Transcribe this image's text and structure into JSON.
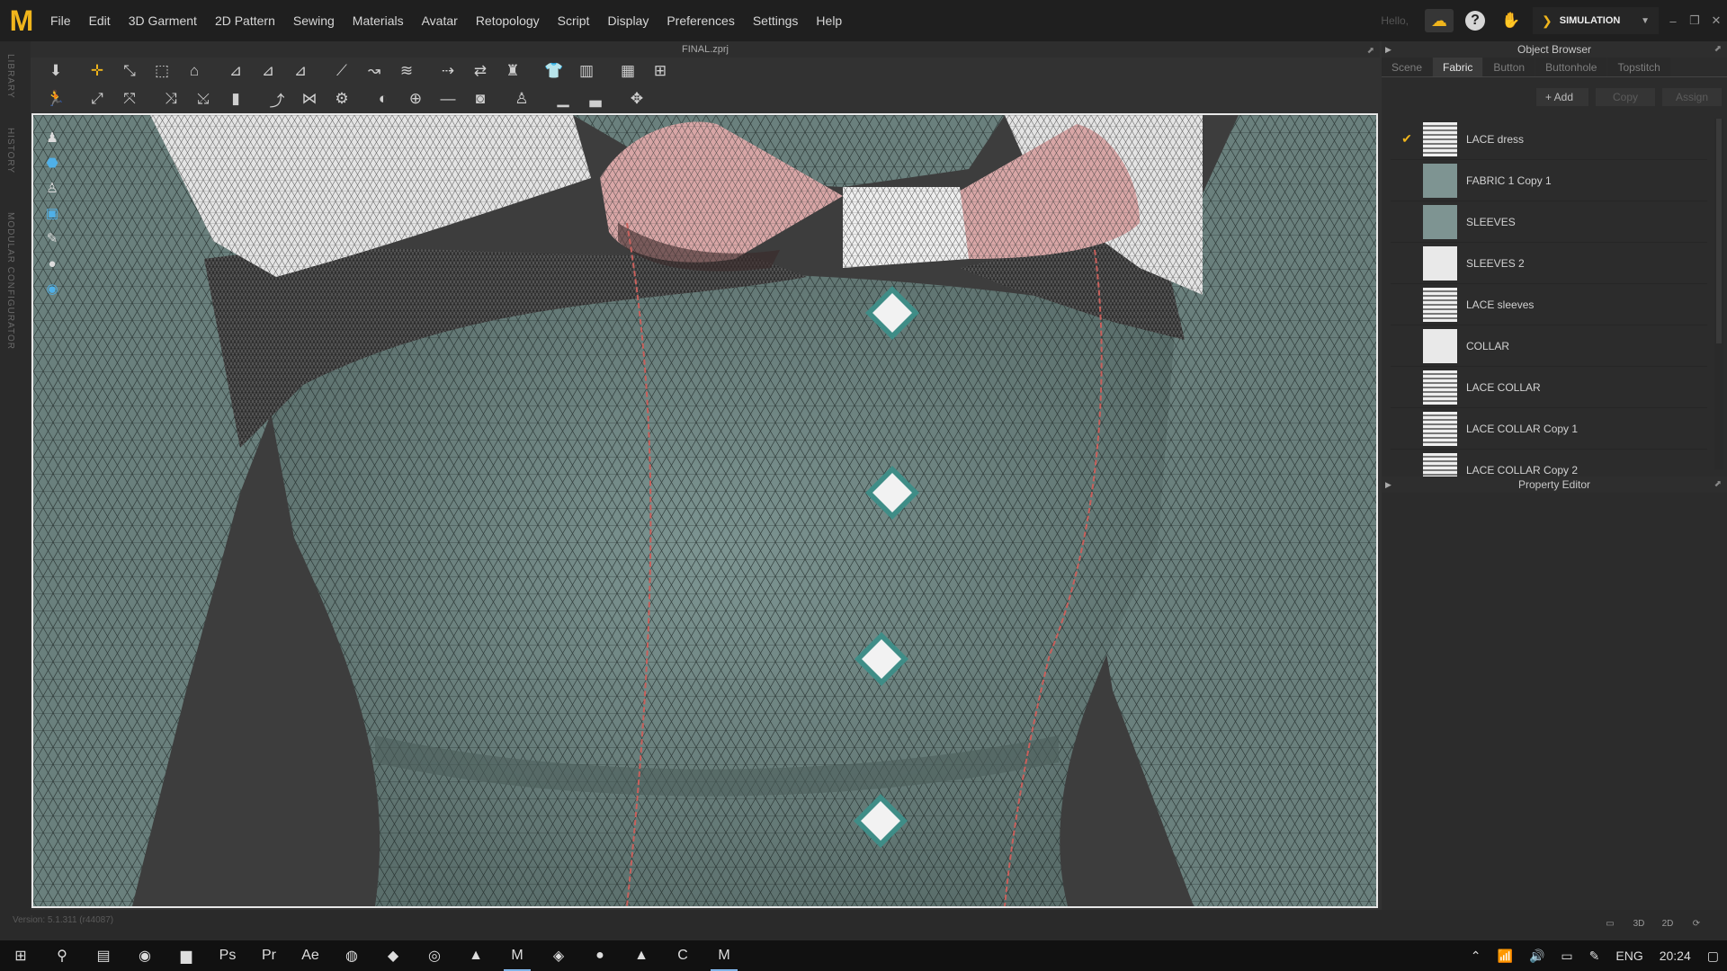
{
  "app": {
    "logo": "M",
    "menu": [
      "File",
      "Edit",
      "3D Garment",
      "2D Pattern",
      "Sewing",
      "Materials",
      "Avatar",
      "Retopology",
      "Script",
      "Display",
      "Preferences",
      "Settings",
      "Help"
    ],
    "greeting": "Hello,",
    "mode_label": "SIMULATION",
    "window_controls": [
      "–",
      "❐",
      "✕"
    ]
  },
  "left_tabs": [
    "LIBRARY",
    "HISTORY",
    "MODULAR CONFIGURATOR"
  ],
  "document": {
    "title": "FINAL.zprj"
  },
  "object_browser": {
    "title": "Object Browser",
    "tabs": [
      {
        "label": "Scene",
        "active": false
      },
      {
        "label": "Fabric",
        "active": true
      },
      {
        "label": "Button",
        "active": false
      },
      {
        "label": "Buttonhole",
        "active": false
      },
      {
        "label": "Topstitch",
        "active": false
      }
    ],
    "add_label": "+ Add",
    "copy_label": "Copy",
    "assign_label": "Assign",
    "fabrics": [
      {
        "name": "LACE dress",
        "checked": true,
        "thumb": "lace"
      },
      {
        "name": "FABRIC 1 Copy 1",
        "checked": false,
        "thumb": "teal"
      },
      {
        "name": "SLEEVES",
        "checked": false,
        "thumb": "teal"
      },
      {
        "name": "SLEEVES 2",
        "checked": false,
        "thumb": "white"
      },
      {
        "name": "LACE sleeves",
        "checked": false,
        "thumb": "lace"
      },
      {
        "name": "COLLAR",
        "checked": false,
        "thumb": "white"
      },
      {
        "name": "LACE COLLAR",
        "checked": false,
        "thumb": "lace"
      },
      {
        "name": "LACE COLLAR Copy 1",
        "checked": false,
        "thumb": "lace"
      },
      {
        "name": "LACE COLLAR Copy 2",
        "checked": false,
        "thumb": "lace"
      }
    ]
  },
  "property_editor": {
    "title": "Property Editor"
  },
  "status": {
    "version": "Version: 5.1.311 (r44087)"
  },
  "view_modes": [
    "▭",
    "3D",
    "2D"
  ],
  "taskbar": {
    "apps": [
      "⊞",
      "⚲",
      "▤",
      "◉",
      "▆",
      "Ps",
      "Pr",
      "Ae",
      "◍",
      "◆",
      "◎",
      "▲",
      "M",
      "◈",
      "●",
      "▲",
      "C",
      "M"
    ],
    "lang": "ENG",
    "time": "20:24"
  },
  "colors": {
    "accent": "#f0b51c",
    "cloth": "#6f8683",
    "collar": "#e4e4e4",
    "bow": "#d8a6a6",
    "seam": "#c8605c"
  }
}
